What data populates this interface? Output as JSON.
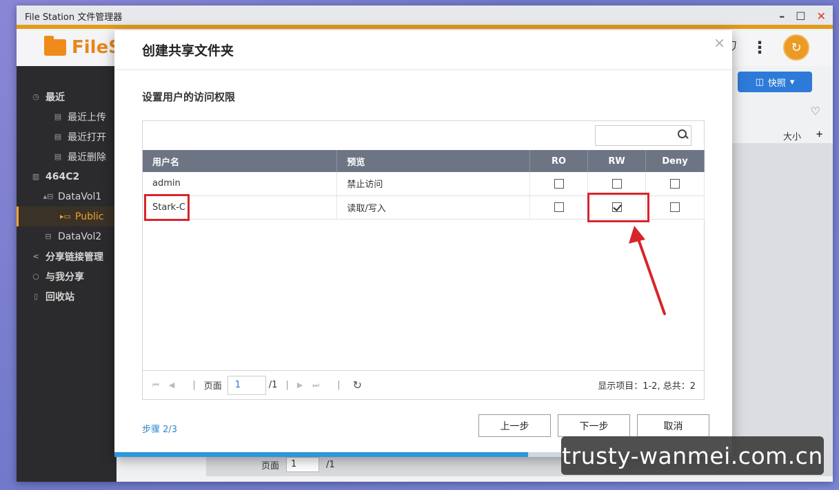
{
  "window": {
    "title": "File Station 文件管理器"
  },
  "app": {
    "logo_text": "FileS"
  },
  "header": {
    "filter_glyph": "⛉",
    "more_glyph": "⋮",
    "user_glyph": "↻"
  },
  "sidebar": {
    "items": [
      {
        "label": "最近",
        "icon": "clock-icon"
      },
      {
        "label": "最近上传",
        "icon": "file-icon"
      },
      {
        "label": "最近打开",
        "icon": "file-icon"
      },
      {
        "label": "最近删除",
        "icon": "file-icon"
      },
      {
        "label": "464C2",
        "icon": "nas-icon"
      },
      {
        "label": "DataVol1",
        "icon": "drive-icon"
      },
      {
        "label": "Public",
        "icon": "folder-icon"
      },
      {
        "label": "DataVol2",
        "icon": "drive-icon"
      },
      {
        "label": "分享链接管理",
        "icon": "share-icon"
      },
      {
        "label": "与我分享",
        "icon": "shared-icon"
      },
      {
        "label": "回收站",
        "icon": "trash-icon"
      }
    ]
  },
  "main": {
    "snapshot_label": "快照",
    "size_column": "大小",
    "plus_column": "+",
    "pager": {
      "page_label": "页面",
      "page_value": "1",
      "page_total": "/1"
    }
  },
  "dialog": {
    "title": "创建共享文件夹",
    "close_glyph": "×",
    "subtitle": "设置用户的访问权限",
    "search": {
      "placeholder": ""
    },
    "table": {
      "headers": [
        "用户名",
        "预览",
        "RO",
        "RW",
        "Deny"
      ],
      "rows": [
        {
          "user": "admin",
          "preview": "禁止访问",
          "preview_type": "deny",
          "ro": false,
          "rw": false,
          "deny": false
        },
        {
          "user": "Stark-C",
          "preview": "读取/写入",
          "preview_type": "rw",
          "ro": false,
          "rw": true,
          "deny": false
        }
      ]
    },
    "pager": {
      "page_label": "页面",
      "page_value": "1",
      "page_total": "/1",
      "info": "显示项目：1-2, 总共：2"
    },
    "step": "步骤 2/3",
    "buttons": {
      "prev": "上一步",
      "next": "下一步",
      "cancel": "取消"
    },
    "progress": 0.67
  },
  "watermark": "trusty-wanmei.com.cn",
  "colors": {
    "accent": "#e39b1b",
    "highlight": "#d8242b",
    "progress": "#2c97d9",
    "primary_button": "#2d7ad8"
  }
}
